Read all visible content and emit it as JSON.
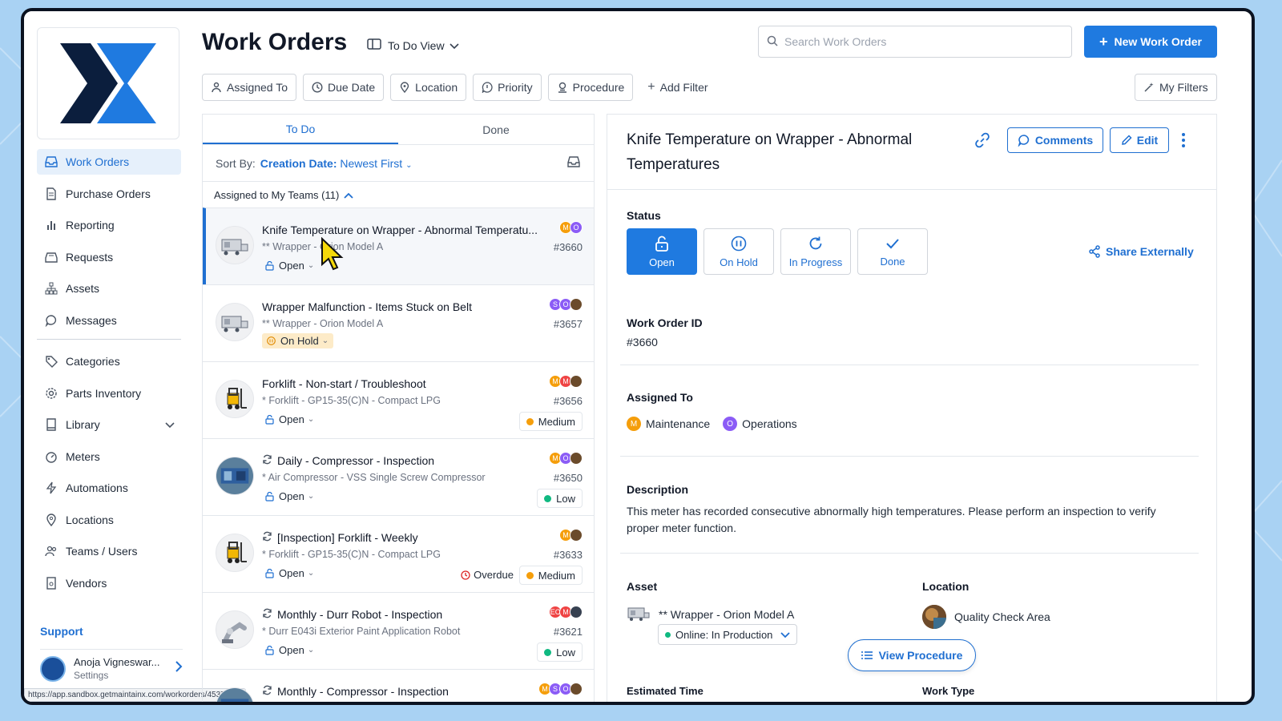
{
  "sidebar": {
    "items": [
      {
        "label": "Work Orders",
        "icon": "inbox-icon",
        "active": true
      },
      {
        "label": "Purchase Orders",
        "icon": "document-icon"
      },
      {
        "label": "Reporting",
        "icon": "bar-chart-icon"
      },
      {
        "label": "Requests",
        "icon": "tray-icon"
      },
      {
        "label": "Assets",
        "icon": "hierarchy-icon"
      },
      {
        "label": "Messages",
        "icon": "chat-icon"
      },
      {
        "label": "Categories",
        "icon": "tag-icon"
      },
      {
        "label": "Parts Inventory",
        "icon": "gear-icon"
      },
      {
        "label": "Library",
        "icon": "book-icon"
      },
      {
        "label": "Meters",
        "icon": "gauge-icon"
      },
      {
        "label": "Automations",
        "icon": "lightning-icon"
      },
      {
        "label": "Locations",
        "icon": "pin-icon"
      },
      {
        "label": "Teams / Users",
        "icon": "users-icon"
      },
      {
        "label": "Vendors",
        "icon": "vendor-icon"
      }
    ],
    "support": "Support",
    "user": {
      "name": "Anoja Vigneswar...",
      "sub": "Settings"
    },
    "status_url": "https://app.sandbox.getmaintainx.com/workorders/45371152"
  },
  "header": {
    "title": "Work Orders",
    "view": "To Do View",
    "search_placeholder": "Search Work Orders",
    "new_button": "New Work Order",
    "filters": [
      "Assigned To",
      "Due Date",
      "Location",
      "Priority",
      "Procedure"
    ],
    "add_filter": "Add Filter",
    "my_filters": "My Filters"
  },
  "list": {
    "tabs": [
      "To Do",
      "Done"
    ],
    "sort_label": "Sort By:",
    "sort_field": "Creation Date:",
    "sort_order": "Newest First",
    "group": "Assigned to My Teams (11)",
    "orders": [
      {
        "title": "Knife Temperature on Wrapper - Abnormal Temperatu...",
        "asset": "** Wrapper - Orion Model A",
        "id": "#3660",
        "status": "Open",
        "avatars": [
          {
            "t": "M",
            "c": "#f59e0b"
          },
          {
            "t": "O",
            "c": "#8b5cf6"
          }
        ]
      },
      {
        "title": "Wrapper Malfunction - Items Stuck on Belt",
        "asset": "** Wrapper - Orion Model A",
        "id": "#3657",
        "status": "On Hold",
        "avatars": [
          {
            "t": "S",
            "c": "#8b5cf6"
          },
          {
            "t": "O",
            "c": "#8b5cf6"
          },
          {
            "t": "",
            "c": "#6b4b2b"
          }
        ]
      },
      {
        "title": "Forklift - Non-start / Troubleshoot",
        "asset": "* Forklift - GP15-35(C)N - Compact LPG",
        "id": "#3656",
        "status": "Open",
        "priority": "Medium",
        "avatars": [
          {
            "t": "M",
            "c": "#f59e0b"
          },
          {
            "t": "M",
            "c": "#ef4444"
          },
          {
            "t": "",
            "c": "#6b4b2b"
          }
        ]
      },
      {
        "title": "Daily - Compressor - Inspection",
        "asset": "* Air Compressor - VSS Single Screw Compressor",
        "id": "#3650",
        "status": "Open",
        "priority": "Low",
        "avatars": [
          {
            "t": "M",
            "c": "#f59e0b"
          },
          {
            "t": "O",
            "c": "#8b5cf6"
          },
          {
            "t": "",
            "c": "#6b4b2b"
          }
        ]
      },
      {
        "title": "[Inspection] Forklift - Weekly",
        "asset": "* Forklift - GP15-35(C)N - Compact LPG",
        "id": "#3633",
        "status": "Open",
        "overdue": "Overdue",
        "priority": "Medium",
        "avatars": [
          {
            "t": "M",
            "c": "#f59e0b"
          },
          {
            "t": "",
            "c": "#6b4b2b"
          }
        ]
      },
      {
        "title": "Monthly - Durr Robot - Inspection",
        "asset": "* Durr E043i Exterior Paint Application Robot",
        "id": "#3621",
        "status": "Open",
        "priority": "Low",
        "avatars": [
          {
            "t": "EC",
            "c": "#ef4444"
          },
          {
            "t": "M",
            "c": "#ef4444"
          },
          {
            "t": "",
            "c": "#374151"
          }
        ]
      },
      {
        "title": "Monthly - Compressor - Inspection",
        "avatars": [
          {
            "t": "M",
            "c": "#f59e0b"
          },
          {
            "t": "S",
            "c": "#8b5cf6"
          },
          {
            "t": "O",
            "c": "#8b5cf6"
          },
          {
            "t": "",
            "c": "#6b4b2b"
          }
        ]
      }
    ]
  },
  "detail": {
    "title": "Knife Temperature on Wrapper - Abnormal Temperatures",
    "comments": "Comments",
    "edit": "Edit",
    "status_label": "Status",
    "statuses": [
      "Open",
      "On Hold",
      "In Progress",
      "Done"
    ],
    "share": "Share Externally",
    "id_label": "Work Order ID",
    "id": "#3660",
    "assigned_label": "Assigned To",
    "teams": [
      {
        "t": "M",
        "name": "Maintenance",
        "c": "#f59e0b"
      },
      {
        "t": "O",
        "name": "Operations",
        "c": "#8b5cf6"
      }
    ],
    "desc_label": "Description",
    "description": "This meter has recorded consecutive abnormally high temperatures. Please perform an inspection to verify proper meter function.",
    "asset_label": "Asset",
    "asset": "** Wrapper - Orion Model A",
    "asset_status": "Online: In Production",
    "location_label": "Location",
    "location": "Quality Check Area",
    "view_procedure": "View Procedure",
    "cut_left": "Estimated Time",
    "cut_right": "Work Type"
  },
  "colors": {
    "accent": "#1f7ae0",
    "medium": "#f59e0b",
    "low": "#10b981"
  }
}
